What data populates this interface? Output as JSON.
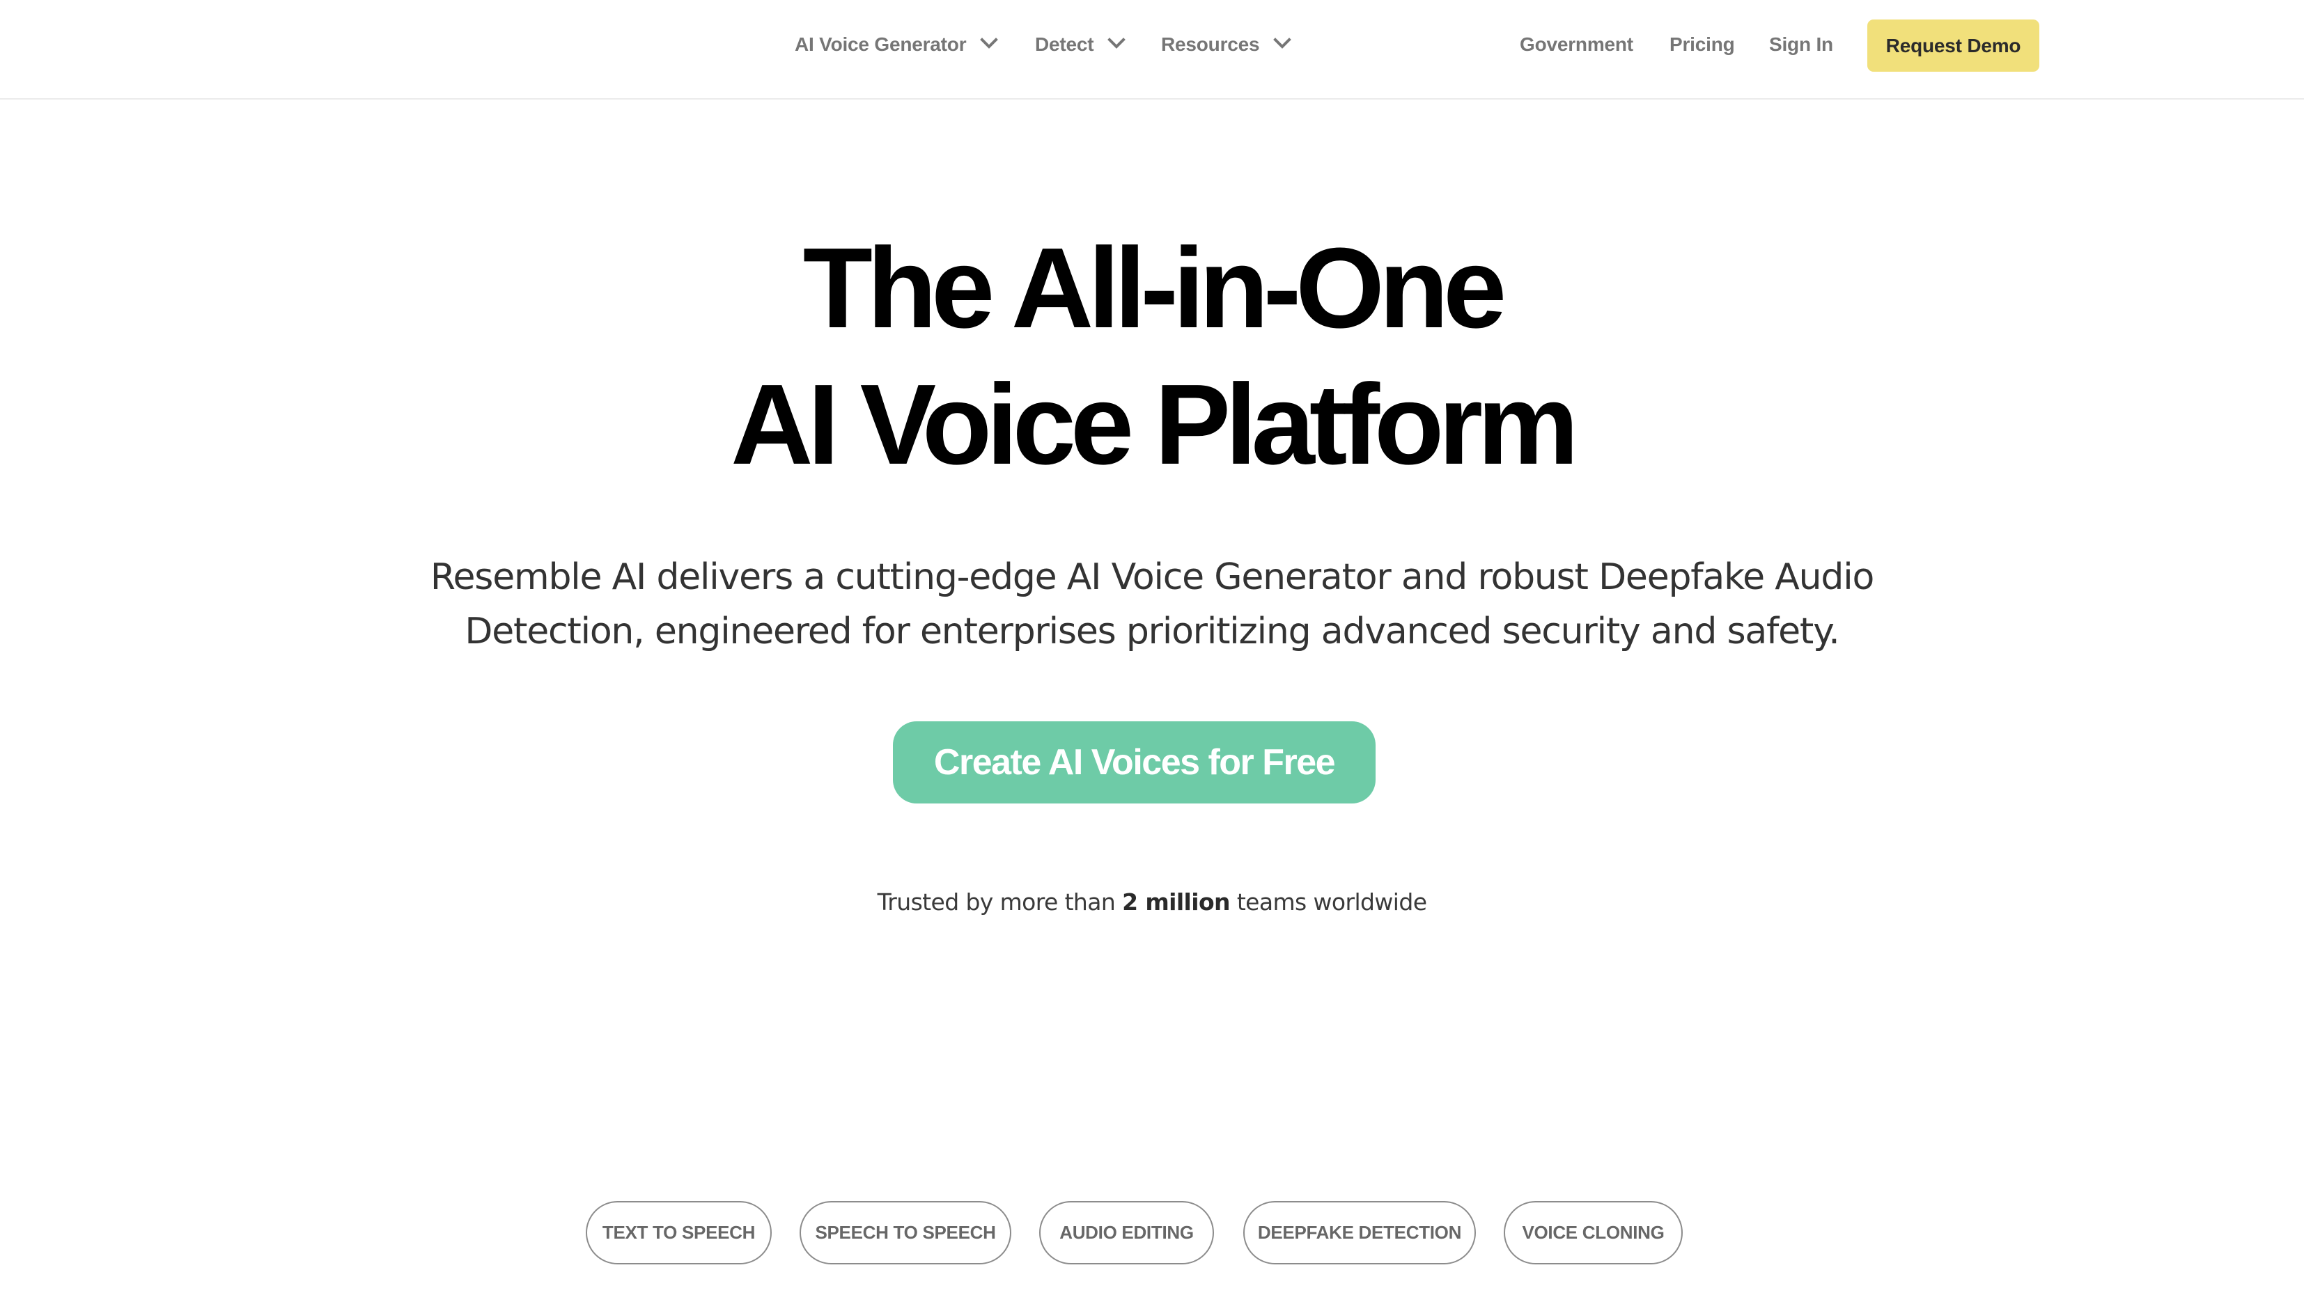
{
  "header": {
    "nav": [
      {
        "label": "AI Voice Generator",
        "has_dropdown": true,
        "icon": "chevron-down-icon"
      },
      {
        "label": "Detect",
        "has_dropdown": true,
        "icon": "chevron-down-icon"
      },
      {
        "label": "Resources",
        "has_dropdown": true,
        "icon": "chevron-down-icon"
      }
    ],
    "links": [
      {
        "label": "Government"
      },
      {
        "label": "Pricing"
      },
      {
        "label": "Sign In"
      }
    ],
    "request_demo_label": "Request Demo"
  },
  "hero": {
    "title_line_1": "The All-in-One",
    "title_line_2": "AI Voice Platform",
    "subtitle_line_1": "Resemble AI delivers a cutting-edge AI Voice Generator and robust Deepfake Audio",
    "subtitle_line_2": "Detection, engineered for enterprises prioritizing advanced security and safety.",
    "cta_label": "Create AI Voices for Free",
    "trusted_prefix": "Trusted by more than ",
    "trusted_highlight": "2 million",
    "trusted_suffix": " teams worldwide"
  },
  "feature_tabs": [
    {
      "label": "TEXT TO SPEECH"
    },
    {
      "label": "SPEECH TO SPEECH"
    },
    {
      "label": "AUDIO EDITING"
    },
    {
      "label": "DEEPFAKE DETECTION"
    },
    {
      "label": "VOICE CLONING"
    }
  ],
  "colors": {
    "cta_green": "#6ecba7",
    "demo_yellow": "#f1e07b",
    "nav_text": "#767676",
    "heading": "#000000",
    "pill_border": "#8c8c8c",
    "pill_text": "#676767"
  }
}
